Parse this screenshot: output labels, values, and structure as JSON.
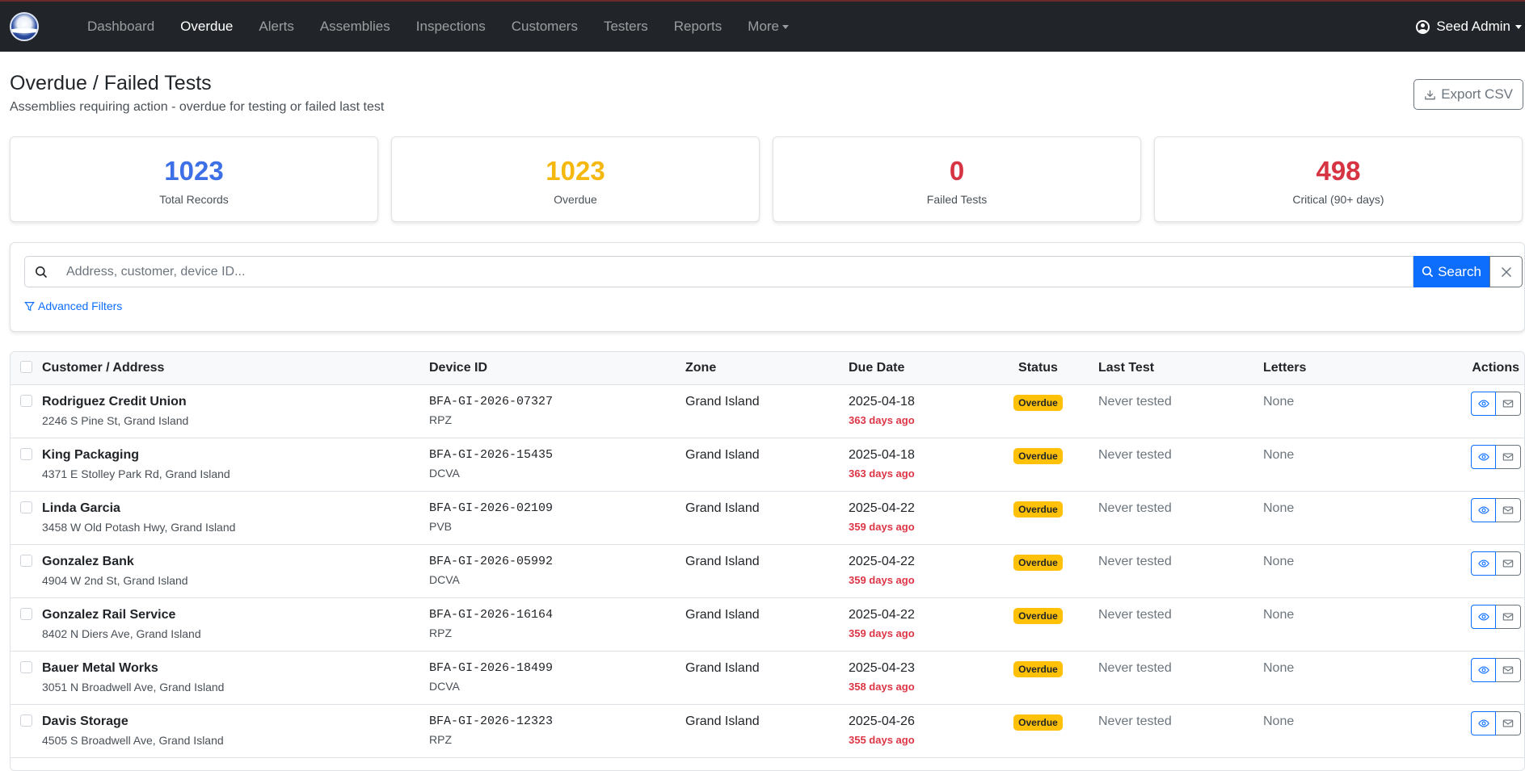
{
  "nav": {
    "items": [
      {
        "label": "Dashboard",
        "active": false
      },
      {
        "label": "Overdue",
        "active": true
      },
      {
        "label": "Alerts",
        "active": false
      },
      {
        "label": "Assemblies",
        "active": false
      },
      {
        "label": "Inspections",
        "active": false
      },
      {
        "label": "Customers",
        "active": false
      },
      {
        "label": "Testers",
        "active": false
      },
      {
        "label": "Reports",
        "active": false
      },
      {
        "label": "More",
        "active": false
      }
    ],
    "user_name": "Seed Admin"
  },
  "header": {
    "title": "Overdue / Failed Tests",
    "subtitle": "Assemblies requiring action - overdue for testing or failed last test",
    "export_label": "Export CSV"
  },
  "stats": [
    {
      "value": "1023",
      "label": "Total Records",
      "color": "#3d6fe6"
    },
    {
      "value": "1023",
      "label": "Overdue",
      "color": "#f5b80f"
    },
    {
      "value": "0",
      "label": "Failed Tests",
      "color": "#d63343"
    },
    {
      "value": "498",
      "label": "Critical (90+ days)",
      "color": "#d63343"
    }
  ],
  "search": {
    "placeholder": "Address, customer, device ID...",
    "value": "",
    "button_label": "Search",
    "advanced_label": "Advanced Filters"
  },
  "table": {
    "columns": {
      "customer": "Customer / Address",
      "device": "Device ID",
      "zone": "Zone",
      "due": "Due Date",
      "status": "Status",
      "last_test": "Last Test",
      "letters": "Letters",
      "actions": "Actions"
    },
    "rows": [
      {
        "name": "Rodriguez Credit Union",
        "address": "2246 S Pine St, Grand Island",
        "device_id": "BFA-GI-2026-07327",
        "device_type": "RPZ",
        "zone": "Grand Island",
        "due_date": "2025-04-18",
        "days_ago": "363 days ago",
        "status": "Overdue",
        "last_test": "Never tested",
        "letters": "None"
      },
      {
        "name": "King Packaging",
        "address": "4371 E Stolley Park Rd, Grand Island",
        "device_id": "BFA-GI-2026-15435",
        "device_type": "DCVA",
        "zone": "Grand Island",
        "due_date": "2025-04-18",
        "days_ago": "363 days ago",
        "status": "Overdue",
        "last_test": "Never tested",
        "letters": "None"
      },
      {
        "name": "Linda Garcia",
        "address": "3458 W Old Potash Hwy, Grand Island",
        "device_id": "BFA-GI-2026-02109",
        "device_type": "PVB",
        "zone": "Grand Island",
        "due_date": "2025-04-22",
        "days_ago": "359 days ago",
        "status": "Overdue",
        "last_test": "Never tested",
        "letters": "None"
      },
      {
        "name": "Gonzalez Bank",
        "address": "4904 W 2nd St, Grand Island",
        "device_id": "BFA-GI-2026-05992",
        "device_type": "DCVA",
        "zone": "Grand Island",
        "due_date": "2025-04-22",
        "days_ago": "359 days ago",
        "status": "Overdue",
        "last_test": "Never tested",
        "letters": "None"
      },
      {
        "name": "Gonzalez Rail Service",
        "address": "8402 N Diers Ave, Grand Island",
        "device_id": "BFA-GI-2026-16164",
        "device_type": "RPZ",
        "zone": "Grand Island",
        "due_date": "2025-04-22",
        "days_ago": "359 days ago",
        "status": "Overdue",
        "last_test": "Never tested",
        "letters": "None"
      },
      {
        "name": "Bauer Metal Works",
        "address": "3051 N Broadwell Ave, Grand Island",
        "device_id": "BFA-GI-2026-18499",
        "device_type": "DCVA",
        "zone": "Grand Island",
        "due_date": "2025-04-23",
        "days_ago": "358 days ago",
        "status": "Overdue",
        "last_test": "Never tested",
        "letters": "None"
      },
      {
        "name": "Davis Storage",
        "address": "4505 S Broadwell Ave, Grand Island",
        "device_id": "BFA-GI-2026-12323",
        "device_type": "RPZ",
        "zone": "Grand Island",
        "due_date": "2025-04-26",
        "days_ago": "355 days ago",
        "status": "Overdue",
        "last_test": "Never tested",
        "letters": "None"
      }
    ]
  }
}
